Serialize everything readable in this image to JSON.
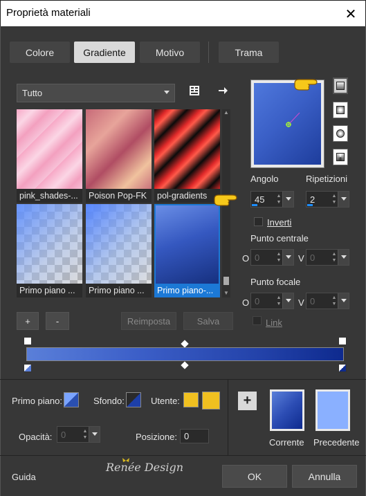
{
  "window": {
    "title": "Proprietà materiali",
    "close_glyph": "✕"
  },
  "tabs": [
    {
      "label": "Colore",
      "active": false
    },
    {
      "label": "Gradiente",
      "active": true
    },
    {
      "label": "Motivo",
      "active": false
    },
    {
      "label": "Trama",
      "active": false
    }
  ],
  "category": {
    "selected": "Tutto"
  },
  "gallery": [
    {
      "label": "pink_shades-...",
      "selected": false
    },
    {
      "label": "Poison Pop-FK",
      "selected": false
    },
    {
      "label": "pol-gradients",
      "selected": false
    },
    {
      "label": "Primo piano ...",
      "selected": false
    },
    {
      "label": "Primo piano ...",
      "selected": false
    },
    {
      "label": "Primo piano-...",
      "selected": true
    }
  ],
  "gallery_buttons": {
    "add": "+",
    "remove": "-",
    "reset": "Reimposta",
    "save": "Salva"
  },
  "gradient": {
    "colors": {
      "start": "#5a7fd9",
      "end": "#0e2a8e"
    }
  },
  "fields": {
    "angle_label": "Angolo",
    "angle_value": "45",
    "repeats_label": "Ripetizioni",
    "repeats_value": "2",
    "invert_label": "Inverti",
    "center_label": "Punto centrale",
    "center_o_label": "O",
    "center_o_value": "0",
    "center_v_label": "V",
    "center_v_value": "0",
    "focal_label": "Punto focale",
    "focal_o_label": "O",
    "focal_o_value": "0",
    "focal_v_label": "V",
    "focal_v_value": "0",
    "link_label": "Link"
  },
  "lower": {
    "foreground_label": "Primo piano:",
    "background_label": "Sfondo:",
    "user_label": "Utente:",
    "user_color": "#f0c020",
    "opacity_label": "Opacità:",
    "opacity_value": "0",
    "position_label": "Posizione:",
    "position_value": "0",
    "add_glyph": "+",
    "current_label": "Corrente",
    "previous_label": "Precedente",
    "previous_color": "#8ab0ff",
    "watermark": "Renée Design"
  },
  "footer": {
    "help": "Guida",
    "ok": "OK",
    "cancel": "Annulla"
  }
}
